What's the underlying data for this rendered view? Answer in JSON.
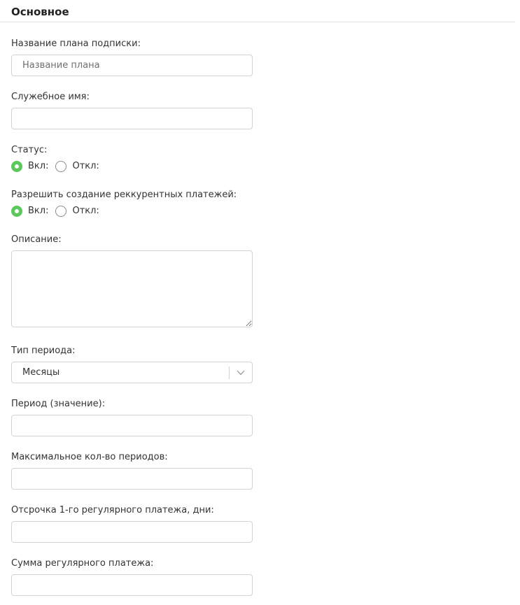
{
  "section": {
    "title": "Основное"
  },
  "plan_name": {
    "label": "Название плана подписки:",
    "placeholder": "Название плана",
    "value": ""
  },
  "service_name": {
    "label": "Служебное имя:",
    "value": ""
  },
  "status": {
    "label": "Статус:",
    "on_label": "Вкл:",
    "off_label": "Откл:",
    "selected": "on"
  },
  "recurring": {
    "label": "Разрешить создание реккурентных платежей:",
    "on_label": "Вкл:",
    "off_label": "Откл:",
    "selected": "on"
  },
  "description": {
    "label": "Описание:",
    "value": ""
  },
  "period_type": {
    "label": "Тип периода:",
    "selected_value": "Месяцы",
    "icon": "chevron-down-icon"
  },
  "period_value": {
    "label": "Период (значение):",
    "value": ""
  },
  "max_periods": {
    "label": "Максимальное кол-во периодов:",
    "value": ""
  },
  "first_payment_delay": {
    "label": "Отсрочка 1-го регулярного платежа, дни:",
    "value": ""
  },
  "regular_amount": {
    "label": "Сумма регулярного платежа:",
    "value": ""
  },
  "colors": {
    "accent_green": "#5cc85c",
    "border": "#d3d3d3",
    "divider": "#e2e2e2"
  }
}
